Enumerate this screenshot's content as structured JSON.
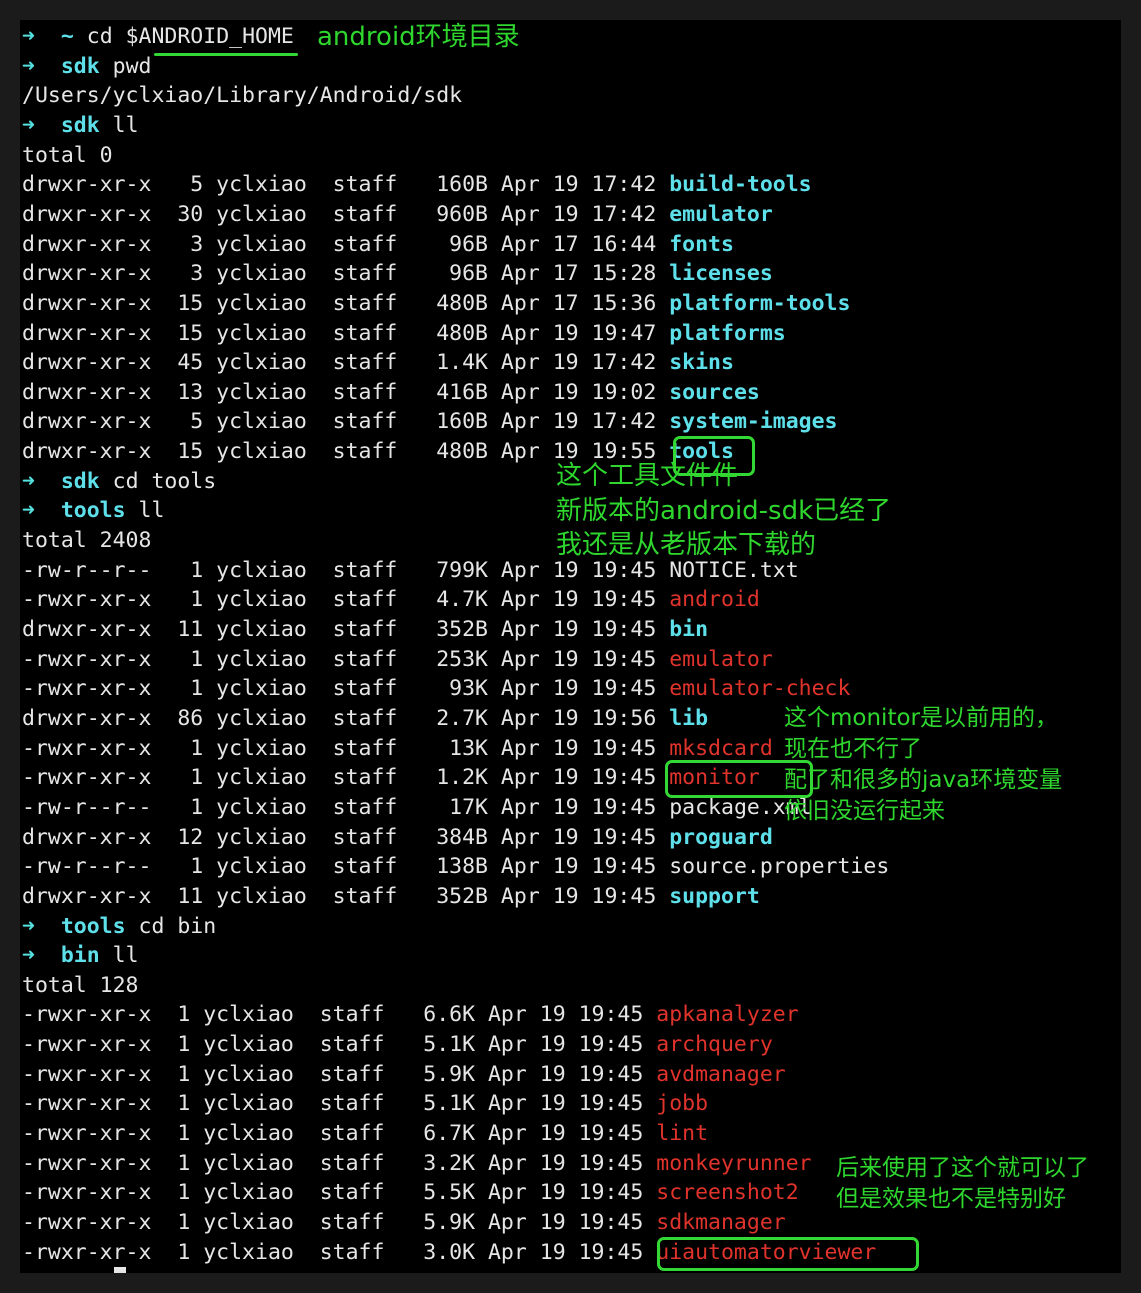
{
  "prompt_symbol": "➜",
  "lines": [
    {
      "kind": "prompt",
      "cwd": "~",
      "cmd": "cd $ANDROID_HOME"
    },
    {
      "kind": "prompt",
      "cwd": "sdk",
      "cmd": "pwd"
    },
    {
      "kind": "output",
      "text": "/Users/yclxiao/Library/Android/sdk"
    },
    {
      "kind": "prompt",
      "cwd": "sdk",
      "cmd": "ll"
    },
    {
      "kind": "output",
      "text": "total 0"
    },
    {
      "kind": "entry",
      "meta": "drwxr-xr-x   5 yclxiao  staff   160B Apr 19 17:42 ",
      "name": "build-tools",
      "type": "dir"
    },
    {
      "kind": "entry",
      "meta": "drwxr-xr-x  30 yclxiao  staff   960B Apr 19 17:42 ",
      "name": "emulator",
      "type": "dir"
    },
    {
      "kind": "entry",
      "meta": "drwxr-xr-x   3 yclxiao  staff    96B Apr 17 16:44 ",
      "name": "fonts",
      "type": "dir"
    },
    {
      "kind": "entry",
      "meta": "drwxr-xr-x   3 yclxiao  staff    96B Apr 17 15:28 ",
      "name": "licenses",
      "type": "dir"
    },
    {
      "kind": "entry",
      "meta": "drwxr-xr-x  15 yclxiao  staff   480B Apr 17 15:36 ",
      "name": "platform-tools",
      "type": "dir"
    },
    {
      "kind": "entry",
      "meta": "drwxr-xr-x  15 yclxiao  staff   480B Apr 19 19:47 ",
      "name": "platforms",
      "type": "dir"
    },
    {
      "kind": "entry",
      "meta": "drwxr-xr-x  45 yclxiao  staff   1.4K Apr 19 17:42 ",
      "name": "skins",
      "type": "dir"
    },
    {
      "kind": "entry",
      "meta": "drwxr-xr-x  13 yclxiao  staff   416B Apr 19 19:02 ",
      "name": "sources",
      "type": "dir"
    },
    {
      "kind": "entry",
      "meta": "drwxr-xr-x   5 yclxiao  staff   160B Apr 19 17:42 ",
      "name": "system-images",
      "type": "dir"
    },
    {
      "kind": "entry",
      "meta": "drwxr-xr-x  15 yclxiao  staff   480B Apr 19 19:55 ",
      "name": "tools",
      "type": "dir"
    },
    {
      "kind": "prompt",
      "cwd": "sdk",
      "cmd": "cd tools"
    },
    {
      "kind": "prompt",
      "cwd": "tools",
      "cmd": "ll"
    },
    {
      "kind": "output",
      "text": "total 2408"
    },
    {
      "kind": "entry",
      "meta": "-rw-r--r--   1 yclxiao  staff   799K Apr 19 19:45 ",
      "name": "NOTICE.txt",
      "type": "file"
    },
    {
      "kind": "entry",
      "meta": "-rwxr-xr-x   1 yclxiao  staff   4.7K Apr 19 19:45 ",
      "name": "android",
      "type": "exec"
    },
    {
      "kind": "entry",
      "meta": "drwxr-xr-x  11 yclxiao  staff   352B Apr 19 19:45 ",
      "name": "bin",
      "type": "dir"
    },
    {
      "kind": "entry",
      "meta": "-rwxr-xr-x   1 yclxiao  staff   253K Apr 19 19:45 ",
      "name": "emulator",
      "type": "exec"
    },
    {
      "kind": "entry",
      "meta": "-rwxr-xr-x   1 yclxiao  staff    93K Apr 19 19:45 ",
      "name": "emulator-check",
      "type": "exec"
    },
    {
      "kind": "entry",
      "meta": "drwxr-xr-x  86 yclxiao  staff   2.7K Apr 19 19:56 ",
      "name": "lib",
      "type": "dir"
    },
    {
      "kind": "entry",
      "meta": "-rwxr-xr-x   1 yclxiao  staff    13K Apr 19 19:45 ",
      "name": "mksdcard",
      "type": "exec"
    },
    {
      "kind": "entry",
      "meta": "-rwxr-xr-x   1 yclxiao  staff   1.2K Apr 19 19:45 ",
      "name": "monitor",
      "type": "exec"
    },
    {
      "kind": "entry",
      "meta": "-rw-r--r--   1 yclxiao  staff    17K Apr 19 19:45 ",
      "name": "package.xml",
      "type": "file"
    },
    {
      "kind": "entry",
      "meta": "drwxr-xr-x  12 yclxiao  staff   384B Apr 19 19:45 ",
      "name": "proguard",
      "type": "dir"
    },
    {
      "kind": "entry",
      "meta": "-rw-r--r--   1 yclxiao  staff   138B Apr 19 19:45 ",
      "name": "source.properties",
      "type": "file"
    },
    {
      "kind": "entry",
      "meta": "drwxr-xr-x  11 yclxiao  staff   352B Apr 19 19:45 ",
      "name": "support",
      "type": "dir"
    },
    {
      "kind": "prompt",
      "cwd": "tools",
      "cmd": "cd bin"
    },
    {
      "kind": "prompt",
      "cwd": "bin",
      "cmd": "ll"
    },
    {
      "kind": "output",
      "text": "total 128"
    },
    {
      "kind": "entry",
      "meta": "-rwxr-xr-x  1 yclxiao  staff   6.6K Apr 19 19:45 ",
      "name": "apkanalyzer",
      "type": "exec"
    },
    {
      "kind": "entry",
      "meta": "-rwxr-xr-x  1 yclxiao  staff   5.1K Apr 19 19:45 ",
      "name": "archquery",
      "type": "exec"
    },
    {
      "kind": "entry",
      "meta": "-rwxr-xr-x  1 yclxiao  staff   5.9K Apr 19 19:45 ",
      "name": "avdmanager",
      "type": "exec"
    },
    {
      "kind": "entry",
      "meta": "-rwxr-xr-x  1 yclxiao  staff   5.1K Apr 19 19:45 ",
      "name": "jobb",
      "type": "exec"
    },
    {
      "kind": "entry",
      "meta": "-rwxr-xr-x  1 yclxiao  staff   6.7K Apr 19 19:45 ",
      "name": "lint",
      "type": "exec"
    },
    {
      "kind": "entry",
      "meta": "-rwxr-xr-x  1 yclxiao  staff   3.2K Apr 19 19:45 ",
      "name": "monkeyrunner",
      "type": "exec"
    },
    {
      "kind": "entry",
      "meta": "-rwxr-xr-x  1 yclxiao  staff   5.5K Apr 19 19:45 ",
      "name": "screenshot2",
      "type": "exec"
    },
    {
      "kind": "entry",
      "meta": "-rwxr-xr-x  1 yclxiao  staff   5.9K Apr 19 19:45 ",
      "name": "sdkmanager",
      "type": "exec"
    },
    {
      "kind": "entry",
      "meta": "-rwxr-xr-x  1 yclxiao  staff   3.0K Apr 19 19:45 ",
      "name": "uiautomatorviewer",
      "type": "exec"
    }
  ],
  "annotations": {
    "android_home": "android环境目录",
    "tools_note": [
      "这个工具文件件",
      "新版本的android-sdk已经了",
      "我还是从老版本下载的"
    ],
    "monitor_note": [
      "这个monitor是以前用的，",
      "现在也不行了",
      "配了和很多的java环境变量",
      "依旧没运行起来"
    ],
    "uiautomator_note": [
      "后来使用了这个就可以了",
      "但是效果也不是特别好"
    ]
  },
  "colors": {
    "background": "#000000",
    "text": "#e6e6e6",
    "directory": "#5ee0ea",
    "executable": "#e0332c",
    "annotation": "#2ed62e"
  }
}
